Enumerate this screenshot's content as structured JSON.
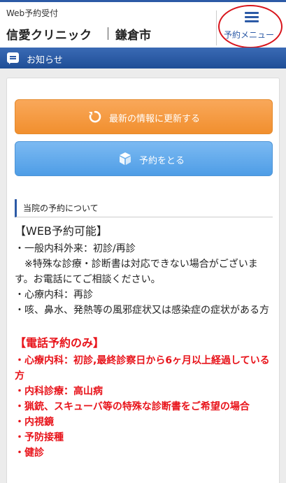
{
  "header": {
    "subtitle": "Web予約受付",
    "clinic_name": "信愛クリニック",
    "city": "鎌倉市",
    "menu_label": "予約メニュー"
  },
  "notice_bar": {
    "title": "お知らせ"
  },
  "buttons": {
    "refresh_label": "最新の情報に更新する",
    "reserve_label": "予約をとる"
  },
  "section": {
    "title": "当院の予約について",
    "web_heading": "【WEB予約可能】",
    "web_lines": [
      "・一般内科外来：初診/再診",
      "　※特殊な診療・診断書は対応できない場合がございます。お電話にてご相談ください。",
      "・心療内科：再診",
      "・咳、鼻水、発熱等の風邪症状又は感染症の症状がある方"
    ],
    "phone_heading": "【電話予約のみ】",
    "phone_lines": [
      "・心療内科：初診,最終診察日から6ヶ月以上経過している方",
      "・内科診療：高山病",
      "・猟銃、スキューバ等の特殊な診断書をご希望の場合",
      "・内視鏡",
      "・予防接種",
      "・健診"
    ]
  },
  "colors": {
    "brand_blue": "#2c5aa6",
    "refresh_orange": "#f39a3f",
    "reserve_blue": "#5ea8ec",
    "alert_red": "#e8141b"
  },
  "icons": {
    "menu": "hamburger-icon",
    "notice": "speech-bubble-icon",
    "refresh": "refresh-icon",
    "reserve": "cube-icon"
  }
}
